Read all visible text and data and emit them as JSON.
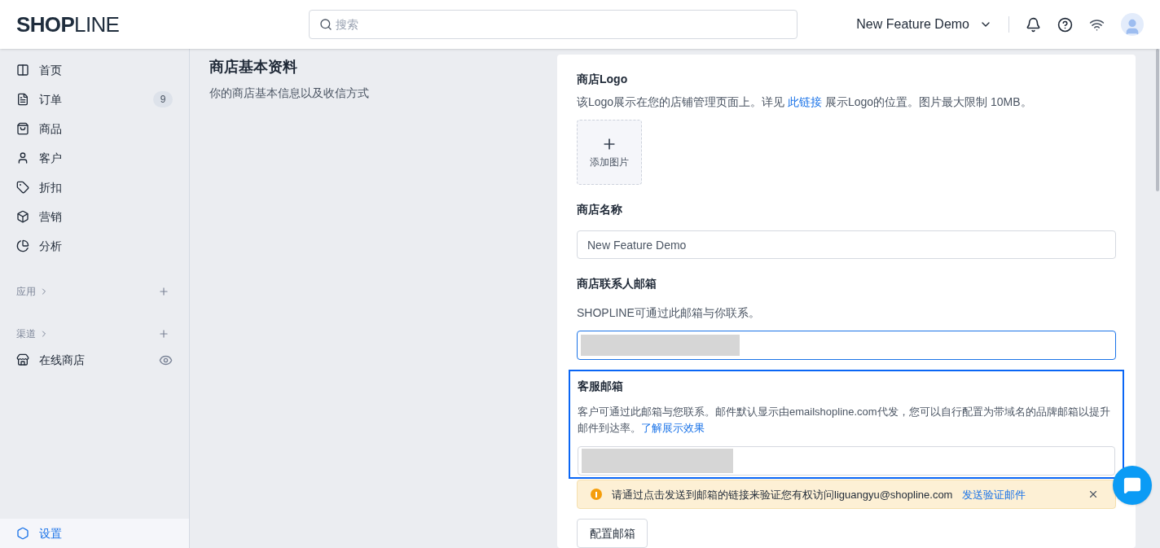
{
  "header": {
    "logo": "**SHOP**LINE",
    "search": {
      "placeholder": "搜索"
    },
    "store_switcher": "New Feature Demo"
  },
  "sidebar": {
    "items": [
      {
        "label": "首页",
        "selected": false
      },
      {
        "label": "订单",
        "badge": "9",
        "selected": false
      },
      {
        "label": "商品",
        "selected": false
      },
      {
        "label": "客户",
        "selected": false
      },
      {
        "label": "折扣",
        "selected": false
      },
      {
        "label": "营销",
        "selected": false
      },
      {
        "label": "分析",
        "selected": false
      }
    ],
    "sections": [
      {
        "label": "应用"
      },
      {
        "label": "渠道",
        "items": [
          {
            "label": "在线商店",
            "selected": false
          }
        ]
      }
    ],
    "footer_item": {
      "label": "设置",
      "selected": true
    }
  },
  "page": {
    "title": "商店基本资料",
    "subtitle": "你的商店基本信息以及收信方式"
  },
  "card": {
    "logo": {
      "label": "商店Logo",
      "help_before": "该Logo展示在您的店铺管理页面上。详见",
      "link": "此链接",
      "help_after": "展示Logo的位置。图片最大限制 10MB。",
      "upload": "添加图片"
    },
    "store_name": {
      "label": "商店名称",
      "value": "New Feature Demo"
    },
    "contact_email": {
      "label": "商店联系人邮箱",
      "help": "SHOPLINE可通过此邮箱与你联系。",
      "focused": true
    },
    "service_email": {
      "label": "客服邮箱",
      "help": "客户可通过此邮箱与您联系。邮件默认显示由emailshopline.com代发，您可以自行配置为带域名的品牌邮箱以提升邮件到达率。",
      "link": "了解展示效果",
      "highlighted": true
    },
    "alert": {
      "text": "请通过点击发送到邮箱的链接来验证您有权访问liguangyu@shopline.com",
      "link": "发送验证邮件"
    },
    "button": "配置邮箱"
  }
}
